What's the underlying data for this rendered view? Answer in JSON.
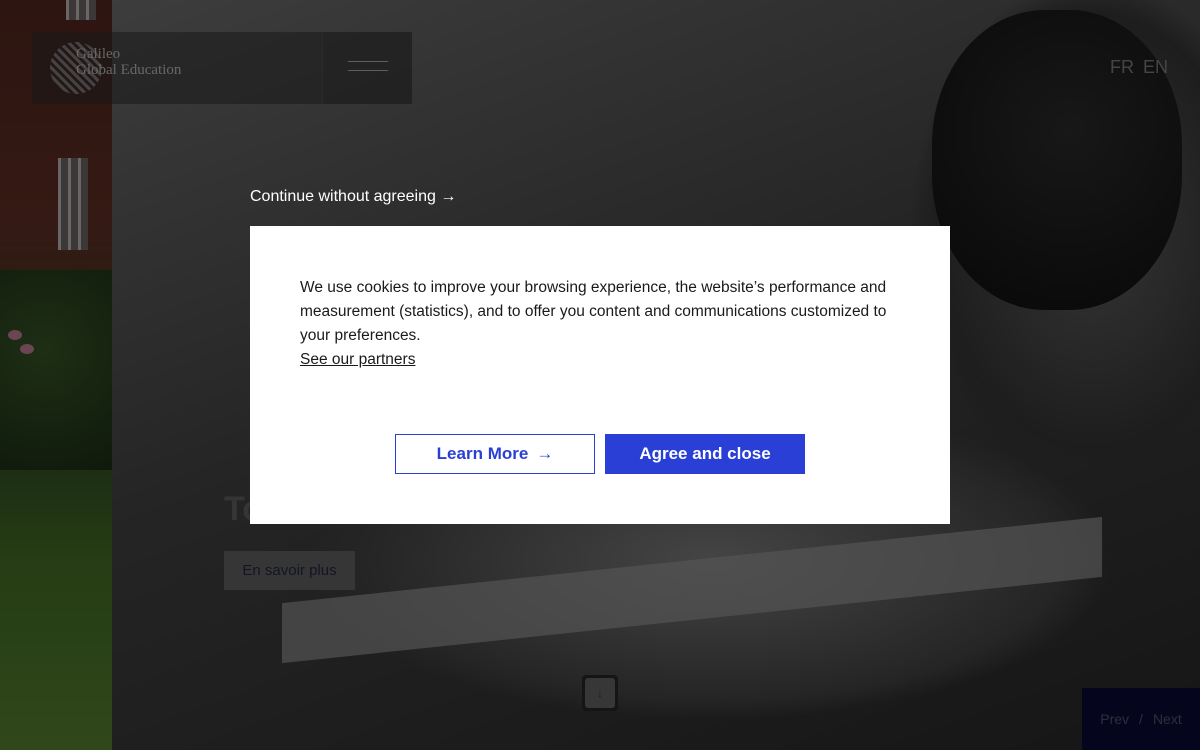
{
  "header": {
    "logo_text_1": "Galileo",
    "logo_text_2": "Global Education",
    "lang_fr": "FR",
    "lang_en": "EN"
  },
  "hero": {
    "title_visible": "To",
    "cta_label": "En savoir plus",
    "scroll_glyph": "↓"
  },
  "slider": {
    "prev": "Prev",
    "separator": "/",
    "next": "Next"
  },
  "consent": {
    "continue_label": "Continue without agreeing",
    "continue_arrow": "→",
    "body": "We use cookies to improve your browsing experience, the website’s performance and measurement (statistics), and to offer you content and communications customized to your preferences.",
    "partners_link": "See our partners",
    "learn_more_label": "Learn More",
    "learn_more_arrow": "→",
    "agree_label": "Agree and close"
  },
  "colors": {
    "accent": "#2a3fd6",
    "modal_bg": "#ffffff",
    "overlay": "rgba(0,0,0,0.5)"
  }
}
